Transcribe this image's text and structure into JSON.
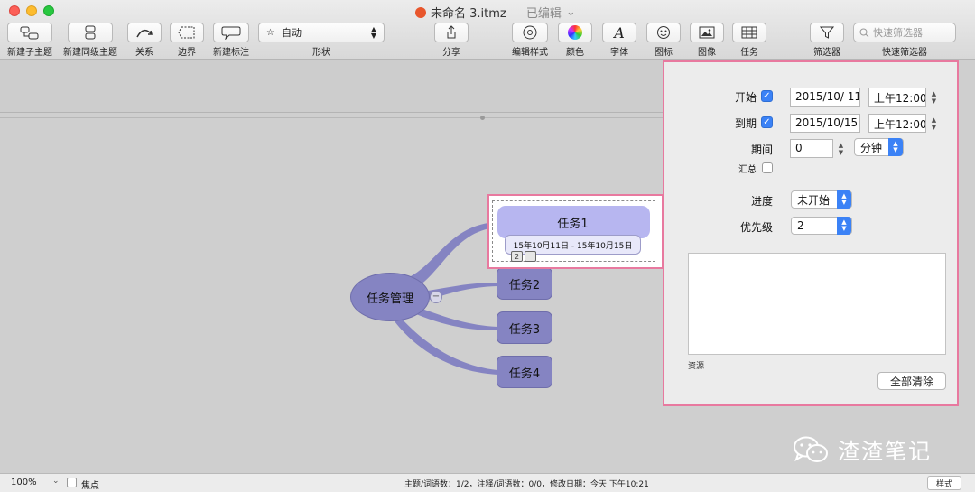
{
  "window": {
    "title": "未命名 3.itmz",
    "status": "— 已编辑"
  },
  "toolbar": {
    "items": [
      {
        "label": "新建子主题",
        "icon": "new-subtopic-icon"
      },
      {
        "label": "新建同级主题",
        "icon": "new-sibling-topic-icon"
      },
      {
        "label": "关系",
        "icon": "relationship-icon"
      },
      {
        "label": "边界",
        "icon": "boundary-icon"
      },
      {
        "label": "新建标注",
        "icon": "callout-icon"
      }
    ],
    "shape": {
      "label": "形状",
      "value": "自动",
      "icon": "star-icon"
    },
    "share": {
      "label": "分享",
      "icon": "share-icon"
    },
    "edit_style": {
      "label": "编辑样式",
      "icon": "edit-style-icon"
    },
    "color": {
      "label": "颜色",
      "icon": "color-wheel-icon"
    },
    "font": {
      "label": "字体",
      "icon": "font-icon"
    },
    "sticker": {
      "label": "图标",
      "icon": "emoji-icon"
    },
    "image": {
      "label": "图像",
      "icon": "image-icon"
    },
    "task": {
      "label": "任务",
      "icon": "task-grid-icon"
    },
    "filter": {
      "label": "筛选器",
      "icon": "funnel-icon"
    },
    "quick_filter": {
      "label": "快速筛选器",
      "placeholder": "快速筛选器",
      "icon": "search-icon"
    }
  },
  "mindmap": {
    "central": "任务管理",
    "collapse_symbol": "−",
    "topics": [
      {
        "label": "任务1",
        "date_range": "15年10月11日 - 15年10月15日",
        "priority_badge": "2"
      },
      {
        "label": "任务2"
      },
      {
        "label": "任务3"
      },
      {
        "label": "任务4"
      }
    ],
    "branch_color": "#8584c2",
    "selected_color": "#b7b6f0"
  },
  "task_panel": {
    "accent": "#e8799f",
    "start": {
      "label": "开始",
      "checked": true,
      "date": "2015/10/ 11",
      "time": "上午12:00"
    },
    "due": {
      "label": "到期",
      "checked": true,
      "date": "2015/10/15",
      "time": "上午12:00"
    },
    "duration": {
      "label": "期间",
      "value": "0",
      "unit": "分钟"
    },
    "rollup": {
      "label": "汇总",
      "checked": false
    },
    "progress": {
      "label": "进度",
      "value": "未开始"
    },
    "priority": {
      "label": "优先级",
      "value": "2"
    },
    "resources_label": "资源",
    "clear_all": "全部清除"
  },
  "statusbar": {
    "zoom": "100%",
    "focus_label": "焦点",
    "stats": "主题/词语数：1/2，注释/词语数：0/0，修改日期：今天 下午10:21",
    "style_button": "样式"
  },
  "watermark": "渣渣笔记"
}
